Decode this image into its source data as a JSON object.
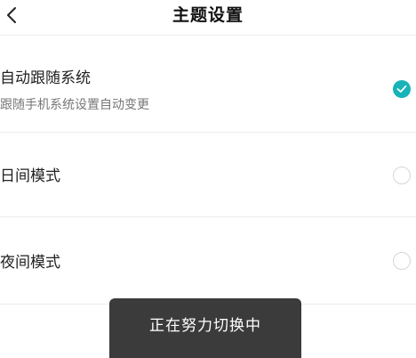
{
  "header": {
    "title": "主题设置",
    "back_icon": "chevron-left-icon"
  },
  "options": [
    {
      "label": "自动跟随系统",
      "sublabel": "跟随手机系统设置自动变更",
      "selected": true
    },
    {
      "label": "日间模式",
      "selected": false
    },
    {
      "label": "夜间模式",
      "selected": false
    }
  ],
  "toast": {
    "text": "正在努力切换中"
  },
  "colors": {
    "accent": "#18b3b8",
    "toast_bg": "#3b3b3b",
    "divider": "#ececec"
  }
}
